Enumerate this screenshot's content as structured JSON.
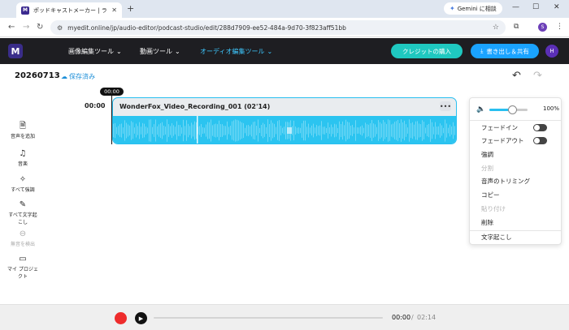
{
  "browser": {
    "tab_title": "ポッドキャストメーカー | ラジオ音声...",
    "tab_favicon": "M",
    "gemini_label": "Gemini に相談",
    "url": "myedit.online/jp/audio-editor/podcast-studio/edit/288d7909-ee52-484a-9d70-3f823aff51bb",
    "profile_initial": "S"
  },
  "header": {
    "logo": "M",
    "menus": [
      "画像編集ツール",
      "動画ツール",
      "オーディオ編集ツール"
    ],
    "credit_button": "クレジットの購入",
    "export_button": "書き出し＆共有",
    "user_initial": "H"
  },
  "project": {
    "name": "20260713",
    "saved_label": "保存済み"
  },
  "sidebar": {
    "items": [
      {
        "label": "音声を追加",
        "icon": "add-audio-icon"
      },
      {
        "label": "音楽",
        "icon": "music-icon"
      },
      {
        "label": "すべて強調",
        "icon": "enhance-icon"
      },
      {
        "label": "すべて文字起こし",
        "icon": "transcribe-icon"
      },
      {
        "label": "無音を検出",
        "icon": "silence-icon"
      },
      {
        "label": "マイ プロジェクト",
        "icon": "folder-icon"
      }
    ]
  },
  "timeline": {
    "time_label": "00:00",
    "playhead_label": "00:00",
    "clip_title": "WonderFox_Video_Recording_001 (02'14)"
  },
  "context_menu": {
    "volume_percent": "100%",
    "volume_value": 1.0,
    "items": [
      {
        "label": "フェードイン",
        "toggle": false
      },
      {
        "label": "フェードアウト",
        "toggle": false
      },
      {
        "label": "強調"
      },
      {
        "label": "分割",
        "disabled": true
      },
      {
        "label": "音声のトリミング"
      },
      {
        "label": "コピー"
      },
      {
        "label": "貼り付け",
        "disabled": true
      },
      {
        "label": "削除"
      },
      {
        "label": "文字起こし"
      }
    ]
  },
  "player": {
    "current_time": "00:00",
    "separator": "/",
    "total_time": "02:14"
  },
  "colors": {
    "accent": "#29bff0",
    "header_bg": "#1e1e22",
    "credit_btn": "#1fc8c0",
    "export_btn": "#1aa3ff",
    "record": "#ee2c2c"
  }
}
